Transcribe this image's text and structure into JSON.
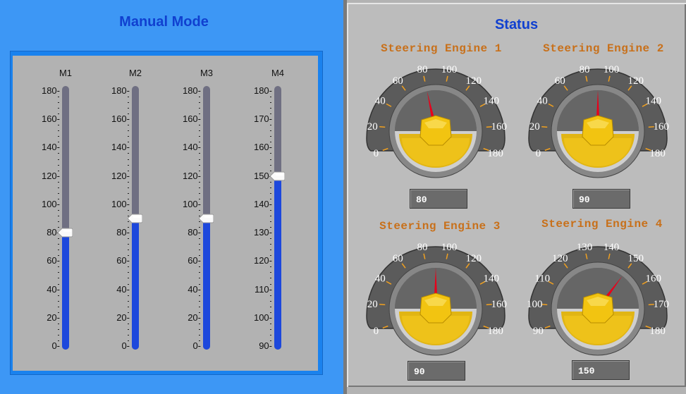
{
  "manual_mode": {
    "title": "Manual Mode",
    "sliders": [
      {
        "label": "M1",
        "value": 80,
        "min": 0,
        "max": 180,
        "ticks": [
          "180",
          "160",
          "140",
          "120",
          "100",
          "80",
          "60",
          "40",
          "20",
          "0"
        ]
      },
      {
        "label": "M2",
        "value": 90,
        "min": 0,
        "max": 180,
        "ticks": [
          "180",
          "160",
          "140",
          "120",
          "100",
          "80",
          "60",
          "40",
          "20",
          "0"
        ]
      },
      {
        "label": "M3",
        "value": 90,
        "min": 0,
        "max": 180,
        "ticks": [
          "180",
          "160",
          "140",
          "120",
          "100",
          "80",
          "60",
          "40",
          "20",
          "0"
        ]
      },
      {
        "label": "M4",
        "value": 150,
        "min": 90,
        "max": 180,
        "ticks": [
          "180",
          "170",
          "160",
          "150",
          "140",
          "130",
          "120",
          "110",
          "100",
          "90"
        ]
      }
    ]
  },
  "status": {
    "title": "Status",
    "gauges": [
      {
        "title": "Steering Engine 1",
        "value": 80,
        "display": "80",
        "min": 0,
        "max": 180,
        "labels": [
          "0",
          "20",
          "40",
          "60",
          "80",
          "100",
          "120",
          "140",
          "160",
          "180"
        ]
      },
      {
        "title": "Steering Engine 2",
        "value": 90,
        "display": "90",
        "min": 0,
        "max": 180,
        "labels": [
          "0",
          "20",
          "40",
          "60",
          "80",
          "100",
          "120",
          "140",
          "160",
          "180"
        ]
      },
      {
        "title": "Steering Engine 3",
        "value": 90,
        "display": "90",
        "min": 0,
        "max": 180,
        "labels": [
          "0",
          "20",
          "40",
          "60",
          "80",
          "100",
          "120",
          "140",
          "160",
          "180"
        ]
      },
      {
        "title": "Steering Engine 4",
        "value": 150,
        "display": "150",
        "min": 90,
        "max": 180,
        "labels": [
          "90",
          "100",
          "110",
          "120",
          "130",
          "140",
          "150",
          "160",
          "170",
          "180"
        ]
      }
    ]
  },
  "colors": {
    "panel_blue": "#3d97f5",
    "title_blue": "#1040d0",
    "slider_fill": "#1d48dc",
    "gauge_title": "#c8701a",
    "needle": "#e8001a",
    "knob": "#f2c411"
  }
}
